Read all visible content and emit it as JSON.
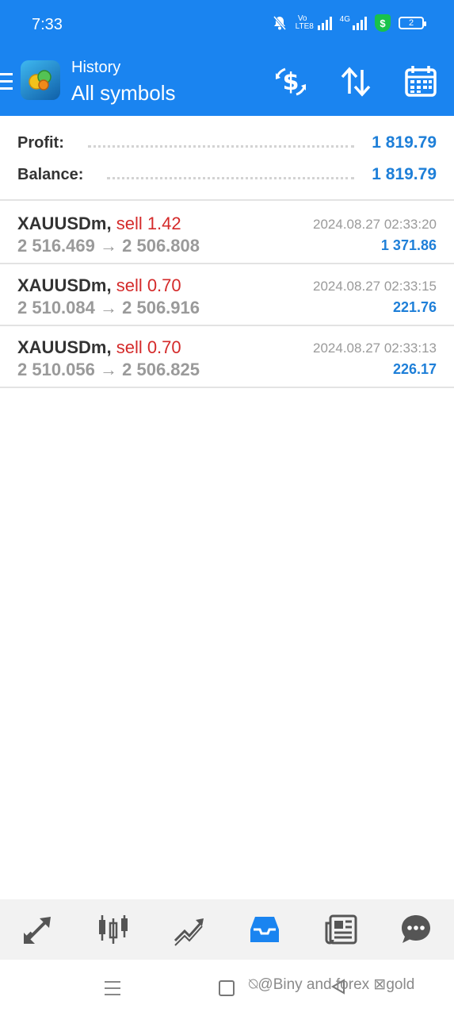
{
  "status_bar": {
    "time": "7:33",
    "volte_label": "Vo LTE8",
    "network_label": "4G",
    "shield_symbol": "$",
    "battery_level": "2",
    "icons": [
      "bell-off-icon",
      "signal-icon",
      "shield-icon",
      "battery-icon"
    ]
  },
  "header": {
    "subtitle": "History",
    "title": "All symbols",
    "buttons": [
      "currency-exchange-icon",
      "sort-icon",
      "calendar-icon"
    ],
    "accent_color": "#1a84f0"
  },
  "summary": {
    "profit_label": "Profit:",
    "profit_value": "1 819.79",
    "balance_label": "Balance:",
    "balance_value": "1 819.79"
  },
  "deals": [
    {
      "symbol": "XAUUSDm,",
      "side": "sell 1.42",
      "open_price": "2 516.469",
      "arrow": "→",
      "close_price": "2 506.808",
      "time": "2024.08.27 02:33:20",
      "profit": "1 371.86"
    },
    {
      "symbol": "XAUUSDm,",
      "side": "sell 0.70",
      "open_price": "2 510.084",
      "arrow": "→",
      "close_price": "2 506.916",
      "time": "2024.08.27 02:33:15",
      "profit": "221.76"
    },
    {
      "symbol": "XAUUSDm,",
      "side": "sell 0.70",
      "open_price": "2 510.056",
      "arrow": "→",
      "close_price": "2 506.825",
      "time": "2024.08.27 02:33:13",
      "profit": "226.17"
    }
  ],
  "tab_bar": {
    "tabs": [
      "quotes-icon",
      "chart-icon",
      "trade-icon",
      "history-icon",
      "news-icon",
      "chat-icon"
    ],
    "active": "history-icon"
  },
  "watermark": "⍉@Biny and forex ⊠gold"
}
